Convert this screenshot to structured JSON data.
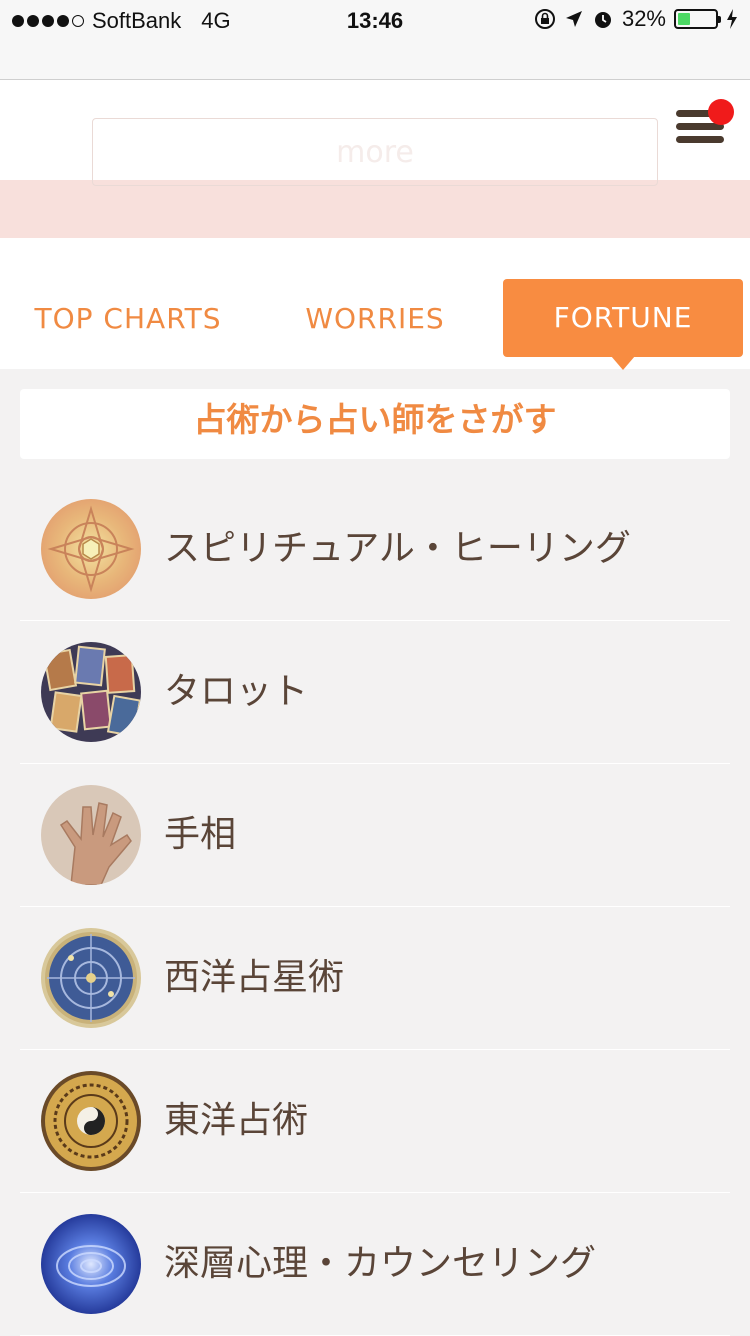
{
  "status_bar": {
    "carrier": "SoftBank",
    "network": "4G",
    "time": "13:46",
    "battery": "32%",
    "battery_level": 0.32
  },
  "header": {
    "more_label": "more",
    "menu_badge_color": "#f01b1b"
  },
  "tabs": [
    {
      "label": "TOP CHARTS",
      "active": false
    },
    {
      "label": "WORRIES",
      "active": false
    },
    {
      "label": "FORTUNE",
      "active": true
    }
  ],
  "section": {
    "title": "占術から占い師をさがす"
  },
  "fortune_list": [
    {
      "label": "スピリチュアル・ヒーリング",
      "icon": "mandala-icon"
    },
    {
      "label": "タロット",
      "icon": "tarot-cards-icon"
    },
    {
      "label": "手相",
      "icon": "palm-icon"
    },
    {
      "label": "西洋占星術",
      "icon": "astrolabe-icon"
    },
    {
      "label": "東洋占術",
      "icon": "yin-yang-compass-icon"
    },
    {
      "label": "深層心理・カウンセリング",
      "icon": "water-ripple-icon"
    }
  ],
  "colors": {
    "accent": "#f88c41",
    "text": "#5a4538",
    "pink_band": "#f8e0dc"
  }
}
